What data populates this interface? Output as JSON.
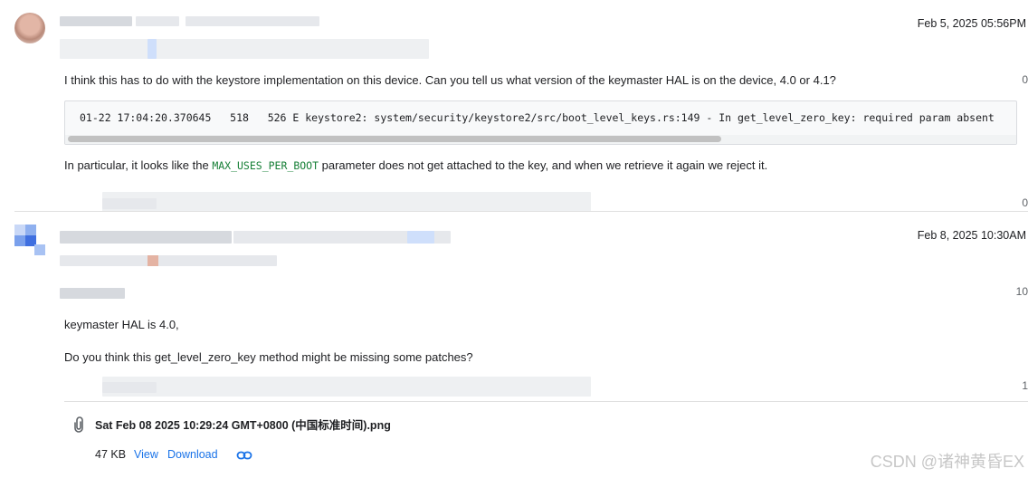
{
  "posts": [
    {
      "date": "Feb 5, 2025 05:56PM",
      "body_line": "I think this has to do with the keystore implementation on this device. Can you tell us what version of the keymaster HAL is on the device, 4.0 or 4.1?",
      "code_line": "01-22 17:04:20.370645   518   526 E keystore2: system/security/keystore2/src/boot_level_keys.rs:149 - In get_level_zero_key: required param absent",
      "particular_prefix": "In particular, it looks like the ",
      "particular_code": "MAX_USES_PER_BOOT",
      "particular_suffix": " parameter does not get attached to the key, and when we retrieve it again we reject it.",
      "counter_top": "0",
      "counter_bottom": "0"
    },
    {
      "date": "Feb 8, 2025 10:30AM",
      "counter_top": "10",
      "line1": "keymaster HAL is 4.0,",
      "line2": "Do you think this get_level_zero_key method might be missing some patches?",
      "counter_bottom": "1",
      "attachment": {
        "name": "Sat Feb 08 2025 10:29:24 GMT+0800 (中国标准时间).png",
        "size": "47 KB",
        "view_label": "View",
        "download_label": "Download"
      }
    }
  ],
  "watermark": "CSDN @诸神黄昏EX",
  "icons": {
    "attachment": "attachment-clip-icon",
    "link": "link-icon"
  },
  "colors": {
    "link": "#1a73e8",
    "inline_code": "#188038"
  }
}
